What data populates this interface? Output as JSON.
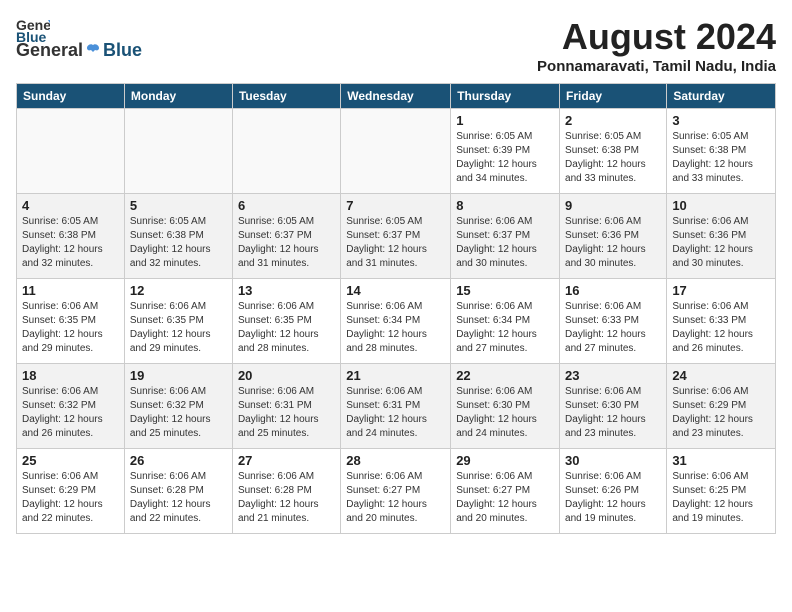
{
  "header": {
    "logo_general": "General",
    "logo_blue": "Blue",
    "month_title": "August 2024",
    "location": "Ponnamaravati, Tamil Nadu, India"
  },
  "columns": [
    "Sunday",
    "Monday",
    "Tuesday",
    "Wednesday",
    "Thursday",
    "Friday",
    "Saturday"
  ],
  "weeks": [
    [
      {
        "day": "",
        "info": ""
      },
      {
        "day": "",
        "info": ""
      },
      {
        "day": "",
        "info": ""
      },
      {
        "day": "",
        "info": ""
      },
      {
        "day": "1",
        "info": "Sunrise: 6:05 AM\nSunset: 6:39 PM\nDaylight: 12 hours\nand 34 minutes."
      },
      {
        "day": "2",
        "info": "Sunrise: 6:05 AM\nSunset: 6:38 PM\nDaylight: 12 hours\nand 33 minutes."
      },
      {
        "day": "3",
        "info": "Sunrise: 6:05 AM\nSunset: 6:38 PM\nDaylight: 12 hours\nand 33 minutes."
      }
    ],
    [
      {
        "day": "4",
        "info": "Sunrise: 6:05 AM\nSunset: 6:38 PM\nDaylight: 12 hours\nand 32 minutes."
      },
      {
        "day": "5",
        "info": "Sunrise: 6:05 AM\nSunset: 6:38 PM\nDaylight: 12 hours\nand 32 minutes."
      },
      {
        "day": "6",
        "info": "Sunrise: 6:05 AM\nSunset: 6:37 PM\nDaylight: 12 hours\nand 31 minutes."
      },
      {
        "day": "7",
        "info": "Sunrise: 6:05 AM\nSunset: 6:37 PM\nDaylight: 12 hours\nand 31 minutes."
      },
      {
        "day": "8",
        "info": "Sunrise: 6:06 AM\nSunset: 6:37 PM\nDaylight: 12 hours\nand 30 minutes."
      },
      {
        "day": "9",
        "info": "Sunrise: 6:06 AM\nSunset: 6:36 PM\nDaylight: 12 hours\nand 30 minutes."
      },
      {
        "day": "10",
        "info": "Sunrise: 6:06 AM\nSunset: 6:36 PM\nDaylight: 12 hours\nand 30 minutes."
      }
    ],
    [
      {
        "day": "11",
        "info": "Sunrise: 6:06 AM\nSunset: 6:35 PM\nDaylight: 12 hours\nand 29 minutes."
      },
      {
        "day": "12",
        "info": "Sunrise: 6:06 AM\nSunset: 6:35 PM\nDaylight: 12 hours\nand 29 minutes."
      },
      {
        "day": "13",
        "info": "Sunrise: 6:06 AM\nSunset: 6:35 PM\nDaylight: 12 hours\nand 28 minutes."
      },
      {
        "day": "14",
        "info": "Sunrise: 6:06 AM\nSunset: 6:34 PM\nDaylight: 12 hours\nand 28 minutes."
      },
      {
        "day": "15",
        "info": "Sunrise: 6:06 AM\nSunset: 6:34 PM\nDaylight: 12 hours\nand 27 minutes."
      },
      {
        "day": "16",
        "info": "Sunrise: 6:06 AM\nSunset: 6:33 PM\nDaylight: 12 hours\nand 27 minutes."
      },
      {
        "day": "17",
        "info": "Sunrise: 6:06 AM\nSunset: 6:33 PM\nDaylight: 12 hours\nand 26 minutes."
      }
    ],
    [
      {
        "day": "18",
        "info": "Sunrise: 6:06 AM\nSunset: 6:32 PM\nDaylight: 12 hours\nand 26 minutes."
      },
      {
        "day": "19",
        "info": "Sunrise: 6:06 AM\nSunset: 6:32 PM\nDaylight: 12 hours\nand 25 minutes."
      },
      {
        "day": "20",
        "info": "Sunrise: 6:06 AM\nSunset: 6:31 PM\nDaylight: 12 hours\nand 25 minutes."
      },
      {
        "day": "21",
        "info": "Sunrise: 6:06 AM\nSunset: 6:31 PM\nDaylight: 12 hours\nand 24 minutes."
      },
      {
        "day": "22",
        "info": "Sunrise: 6:06 AM\nSunset: 6:30 PM\nDaylight: 12 hours\nand 24 minutes."
      },
      {
        "day": "23",
        "info": "Sunrise: 6:06 AM\nSunset: 6:30 PM\nDaylight: 12 hours\nand 23 minutes."
      },
      {
        "day": "24",
        "info": "Sunrise: 6:06 AM\nSunset: 6:29 PM\nDaylight: 12 hours\nand 23 minutes."
      }
    ],
    [
      {
        "day": "25",
        "info": "Sunrise: 6:06 AM\nSunset: 6:29 PM\nDaylight: 12 hours\nand 22 minutes."
      },
      {
        "day": "26",
        "info": "Sunrise: 6:06 AM\nSunset: 6:28 PM\nDaylight: 12 hours\nand 22 minutes."
      },
      {
        "day": "27",
        "info": "Sunrise: 6:06 AM\nSunset: 6:28 PM\nDaylight: 12 hours\nand 21 minutes."
      },
      {
        "day": "28",
        "info": "Sunrise: 6:06 AM\nSunset: 6:27 PM\nDaylight: 12 hours\nand 20 minutes."
      },
      {
        "day": "29",
        "info": "Sunrise: 6:06 AM\nSunset: 6:27 PM\nDaylight: 12 hours\nand 20 minutes."
      },
      {
        "day": "30",
        "info": "Sunrise: 6:06 AM\nSunset: 6:26 PM\nDaylight: 12 hours\nand 19 minutes."
      },
      {
        "day": "31",
        "info": "Sunrise: 6:06 AM\nSunset: 6:25 PM\nDaylight: 12 hours\nand 19 minutes."
      }
    ]
  ]
}
